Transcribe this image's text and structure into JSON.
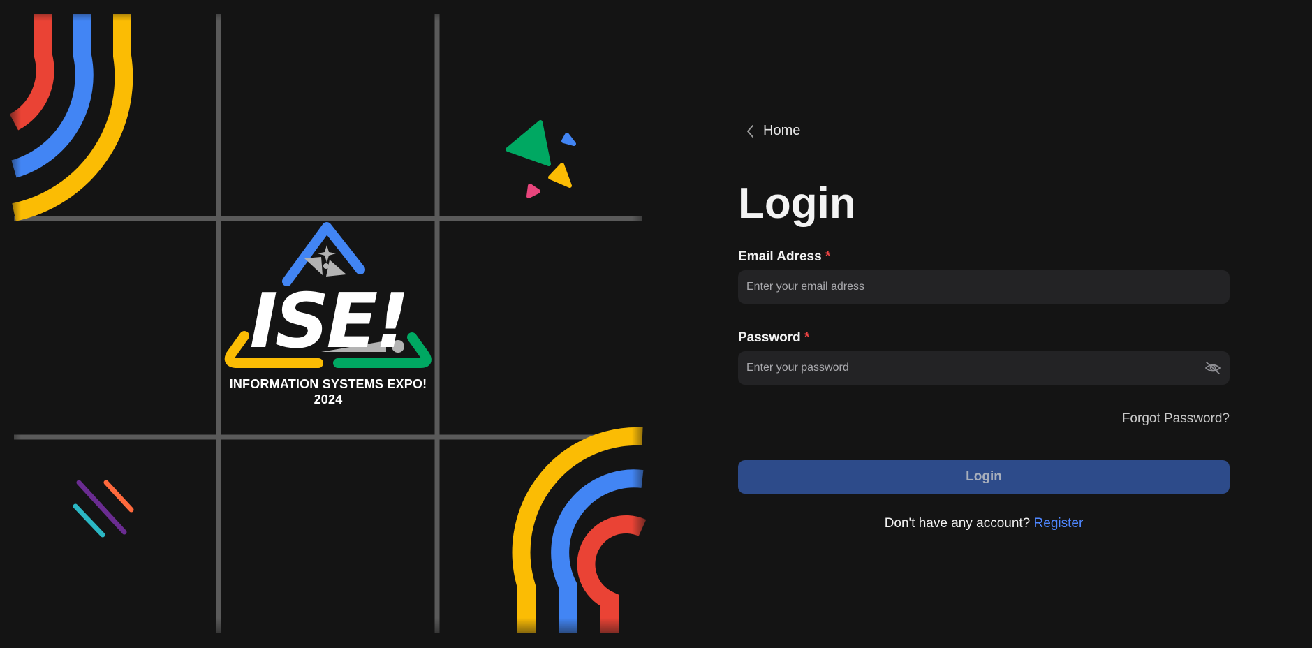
{
  "hero": {
    "logo_text": "ISE!",
    "caption_line1": "INFORMATION SYSTEMS EXPO!",
    "caption_line2": "2024"
  },
  "nav": {
    "back_label": "Home",
    "back_icon": "chevron-left-icon"
  },
  "form": {
    "title": "Login",
    "email": {
      "label": "Email Adress",
      "required_mark": "*",
      "placeholder": "Enter your email adress",
      "value": ""
    },
    "password": {
      "label": "Password",
      "required_mark": "*",
      "placeholder": "Enter your password",
      "value": "",
      "toggle_icon": "eye-off-icon"
    },
    "forgot_label": "Forgot Password?",
    "submit_label": "Login",
    "register_prompt": "Don't have any account?",
    "register_link": "Register"
  },
  "colors": {
    "background": "#141414",
    "grid": "#5a5a5a",
    "red": "#ea4335",
    "blue": "#4285f4",
    "yellow": "#fbbc04",
    "green": "#00a862",
    "pink": "#e8457c",
    "purple": "#6a2c91",
    "orange": "#ff6a3d",
    "teal": "#2bb7c4",
    "input_bg": "#232325",
    "button_bg": "#2d4b8a",
    "link": "#4f87ff"
  }
}
